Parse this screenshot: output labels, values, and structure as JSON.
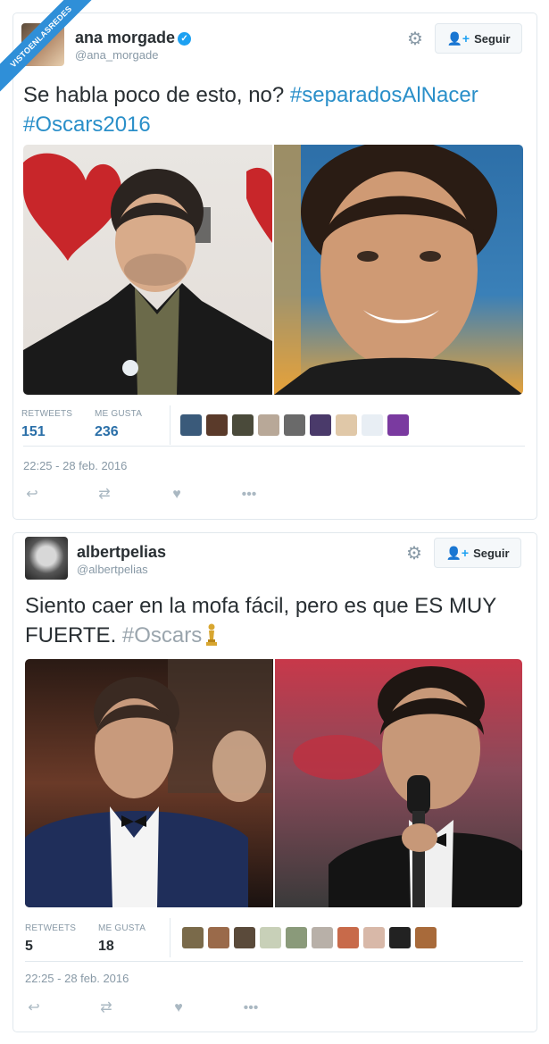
{
  "watermark": {
    "text": "VISTOENLASREDES"
  },
  "tweets": [
    {
      "user": {
        "name": "ana morgade",
        "handle": "@ana_morgade",
        "verified": true
      },
      "follow_label": "Seguir",
      "text_plain": "Se habla poco de esto, no? ",
      "hashtags": [
        "#separadosAlNacer",
        "#Oscars2016"
      ],
      "stats": {
        "retweets_label": "RETWEETS",
        "retweets": "151",
        "likes_label": "ME GUSTA",
        "likes": "236"
      },
      "timestamp": "22:25 - 28 feb. 2016",
      "icons": [
        "reply-icon",
        "retweet-icon",
        "like-icon",
        "more-icon"
      ]
    },
    {
      "user": {
        "name": "albertpelias",
        "handle": "@albertpelias",
        "verified": false
      },
      "follow_label": "Seguir",
      "text_plain": "Siento caer en la mofa fácil, pero es que ES MUY FUERTE. ",
      "hashtags": [
        "#Oscars"
      ],
      "stats": {
        "retweets_label": "RETWEETS",
        "retweets": "5",
        "likes_label": "ME GUSTA",
        "likes": "18"
      },
      "timestamp": "22:25 - 28 feb. 2016",
      "icons": [
        "reply-icon",
        "retweet-icon",
        "like-icon",
        "more-icon"
      ]
    }
  ],
  "colors": {
    "link": "#2a8fc9",
    "muted": "#8899a6",
    "border": "#e1e8ed",
    "accent": "#1da1f2"
  }
}
